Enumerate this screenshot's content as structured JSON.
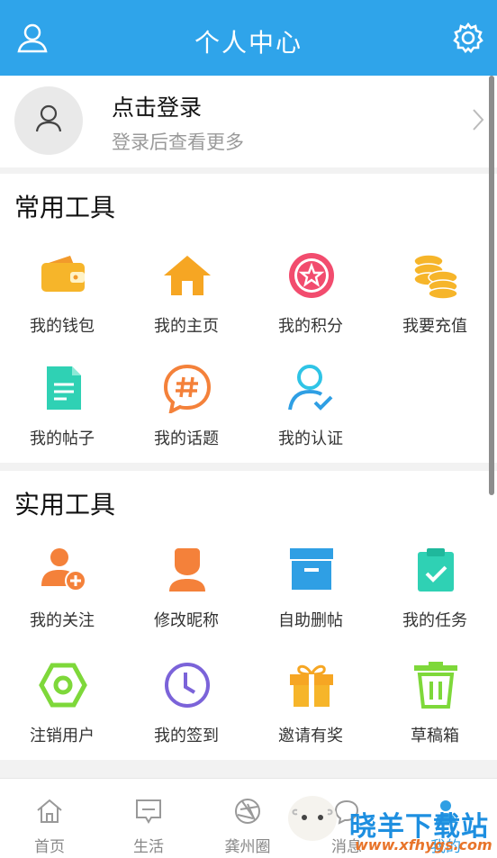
{
  "header": {
    "title": "个人中心",
    "user_icon": "user-icon",
    "settings_icon": "gear-icon"
  },
  "login": {
    "title": "点击登录",
    "subtitle": "登录后查看更多",
    "avatar_icon": "user-avatar-icon"
  },
  "common_tools": {
    "title": "常用工具",
    "items": [
      {
        "label": "我的钱包",
        "icon": "wallet-icon"
      },
      {
        "label": "我的主页",
        "icon": "home-icon"
      },
      {
        "label": "我的积分",
        "icon": "star-badge-icon"
      },
      {
        "label": "我要充值",
        "icon": "coins-icon"
      },
      {
        "label": "我的帖子",
        "icon": "document-icon"
      },
      {
        "label": "我的话题",
        "icon": "hashtag-icon"
      },
      {
        "label": "我的认证",
        "icon": "verified-user-icon"
      }
    ]
  },
  "practical_tools": {
    "title": "实用工具",
    "items": [
      {
        "label": "我的关注",
        "icon": "follow-user-icon"
      },
      {
        "label": "修改昵称",
        "icon": "edit-profile-icon"
      },
      {
        "label": "自助删帖",
        "icon": "archive-box-icon"
      },
      {
        "label": "我的任务",
        "icon": "task-clipboard-icon"
      },
      {
        "label": "注销用户",
        "icon": "hexagon-nut-icon"
      },
      {
        "label": "我的签到",
        "icon": "clock-icon"
      },
      {
        "label": "邀请有奖",
        "icon": "gift-icon"
      },
      {
        "label": "草稿箱",
        "icon": "trash-bin-icon"
      }
    ]
  },
  "tabbar": {
    "items": [
      {
        "label": "首页",
        "icon": "home-outline-icon"
      },
      {
        "label": "生活",
        "icon": "chat-square-icon"
      },
      {
        "label": "龚州圈",
        "icon": "aperture-icon"
      },
      {
        "label": "消息",
        "icon": "message-icon"
      },
      {
        "label": "我的",
        "icon": "profile-icon"
      }
    ]
  },
  "watermark": {
    "title": "晓羊下载站",
    "url": "www.xfhygs.com"
  },
  "colors": {
    "header": "#2fa4ea",
    "wallet": "#f6b52a",
    "points": "#f24c6e",
    "teal": "#2fd1b4",
    "orange": "#f4813a",
    "blue": "#2f9fe4",
    "green": "#7ed83a",
    "purple": "#7b63d9"
  }
}
